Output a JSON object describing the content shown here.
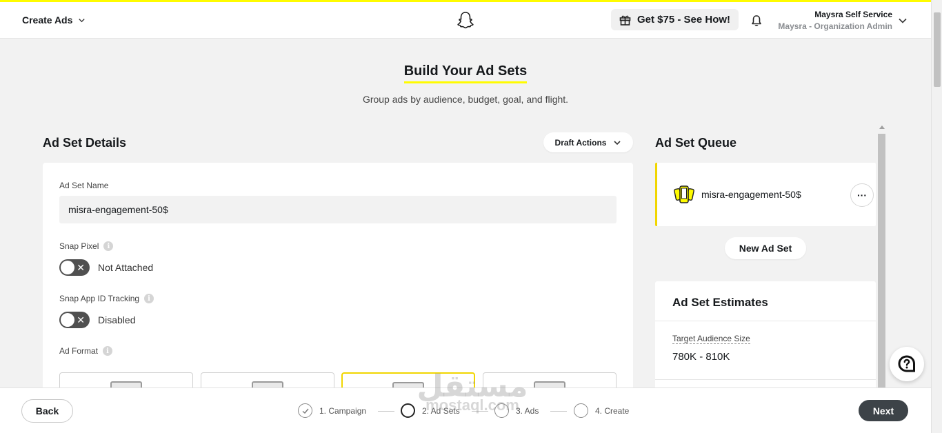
{
  "header": {
    "menu_label": "Create Ads",
    "promo_label": "Get $75 - See How!",
    "user_name": "Maysra Self Service",
    "user_role": "Maysra - Organization Admin"
  },
  "page": {
    "title": "Build Your Ad Sets",
    "subtitle": "Group ads by audience, budget, goal, and flight."
  },
  "details": {
    "section_title": "Ad Set Details",
    "draft_actions_label": "Draft Actions",
    "name_label": "Ad Set Name",
    "name_value": "misra-engagement-50$",
    "snap_pixel_label": "Snap Pixel",
    "snap_pixel_state": "Not Attached",
    "app_id_label": "Snap App ID Tracking",
    "app_id_state": "Disabled",
    "ad_format_label": "Ad Format"
  },
  "queue": {
    "section_title": "Ad Set Queue",
    "items": [
      {
        "name": "misra-engagement-50$"
      }
    ],
    "new_button_label": "New Ad Set"
  },
  "estimates": {
    "title": "Ad Set Estimates",
    "audience_label": "Target Audience Size",
    "audience_value": "780K - 810K"
  },
  "footer": {
    "back_label": "Back",
    "next_label": "Next",
    "steps": [
      {
        "label": "1. Campaign",
        "state": "done"
      },
      {
        "label": "2. Ad Sets",
        "state": "active"
      },
      {
        "label": "3. Ads",
        "state": "pending"
      },
      {
        "label": "4. Create",
        "state": "pending"
      }
    ]
  },
  "watermark": {
    "arabic": "مستقل",
    "latin": "mostaql.com"
  },
  "colors": {
    "brand_yellow": "#fffc00",
    "accent_border": "#f1d600",
    "next_button": "#3d4348",
    "toggle_off": "#505050"
  },
  "icons": [
    "chevron-down-icon",
    "ghost-logo-icon",
    "gift-icon",
    "bell-icon",
    "info-icon",
    "close-icon",
    "phone-ad-icon",
    "more-icon",
    "help-icon",
    "check-icon"
  ]
}
